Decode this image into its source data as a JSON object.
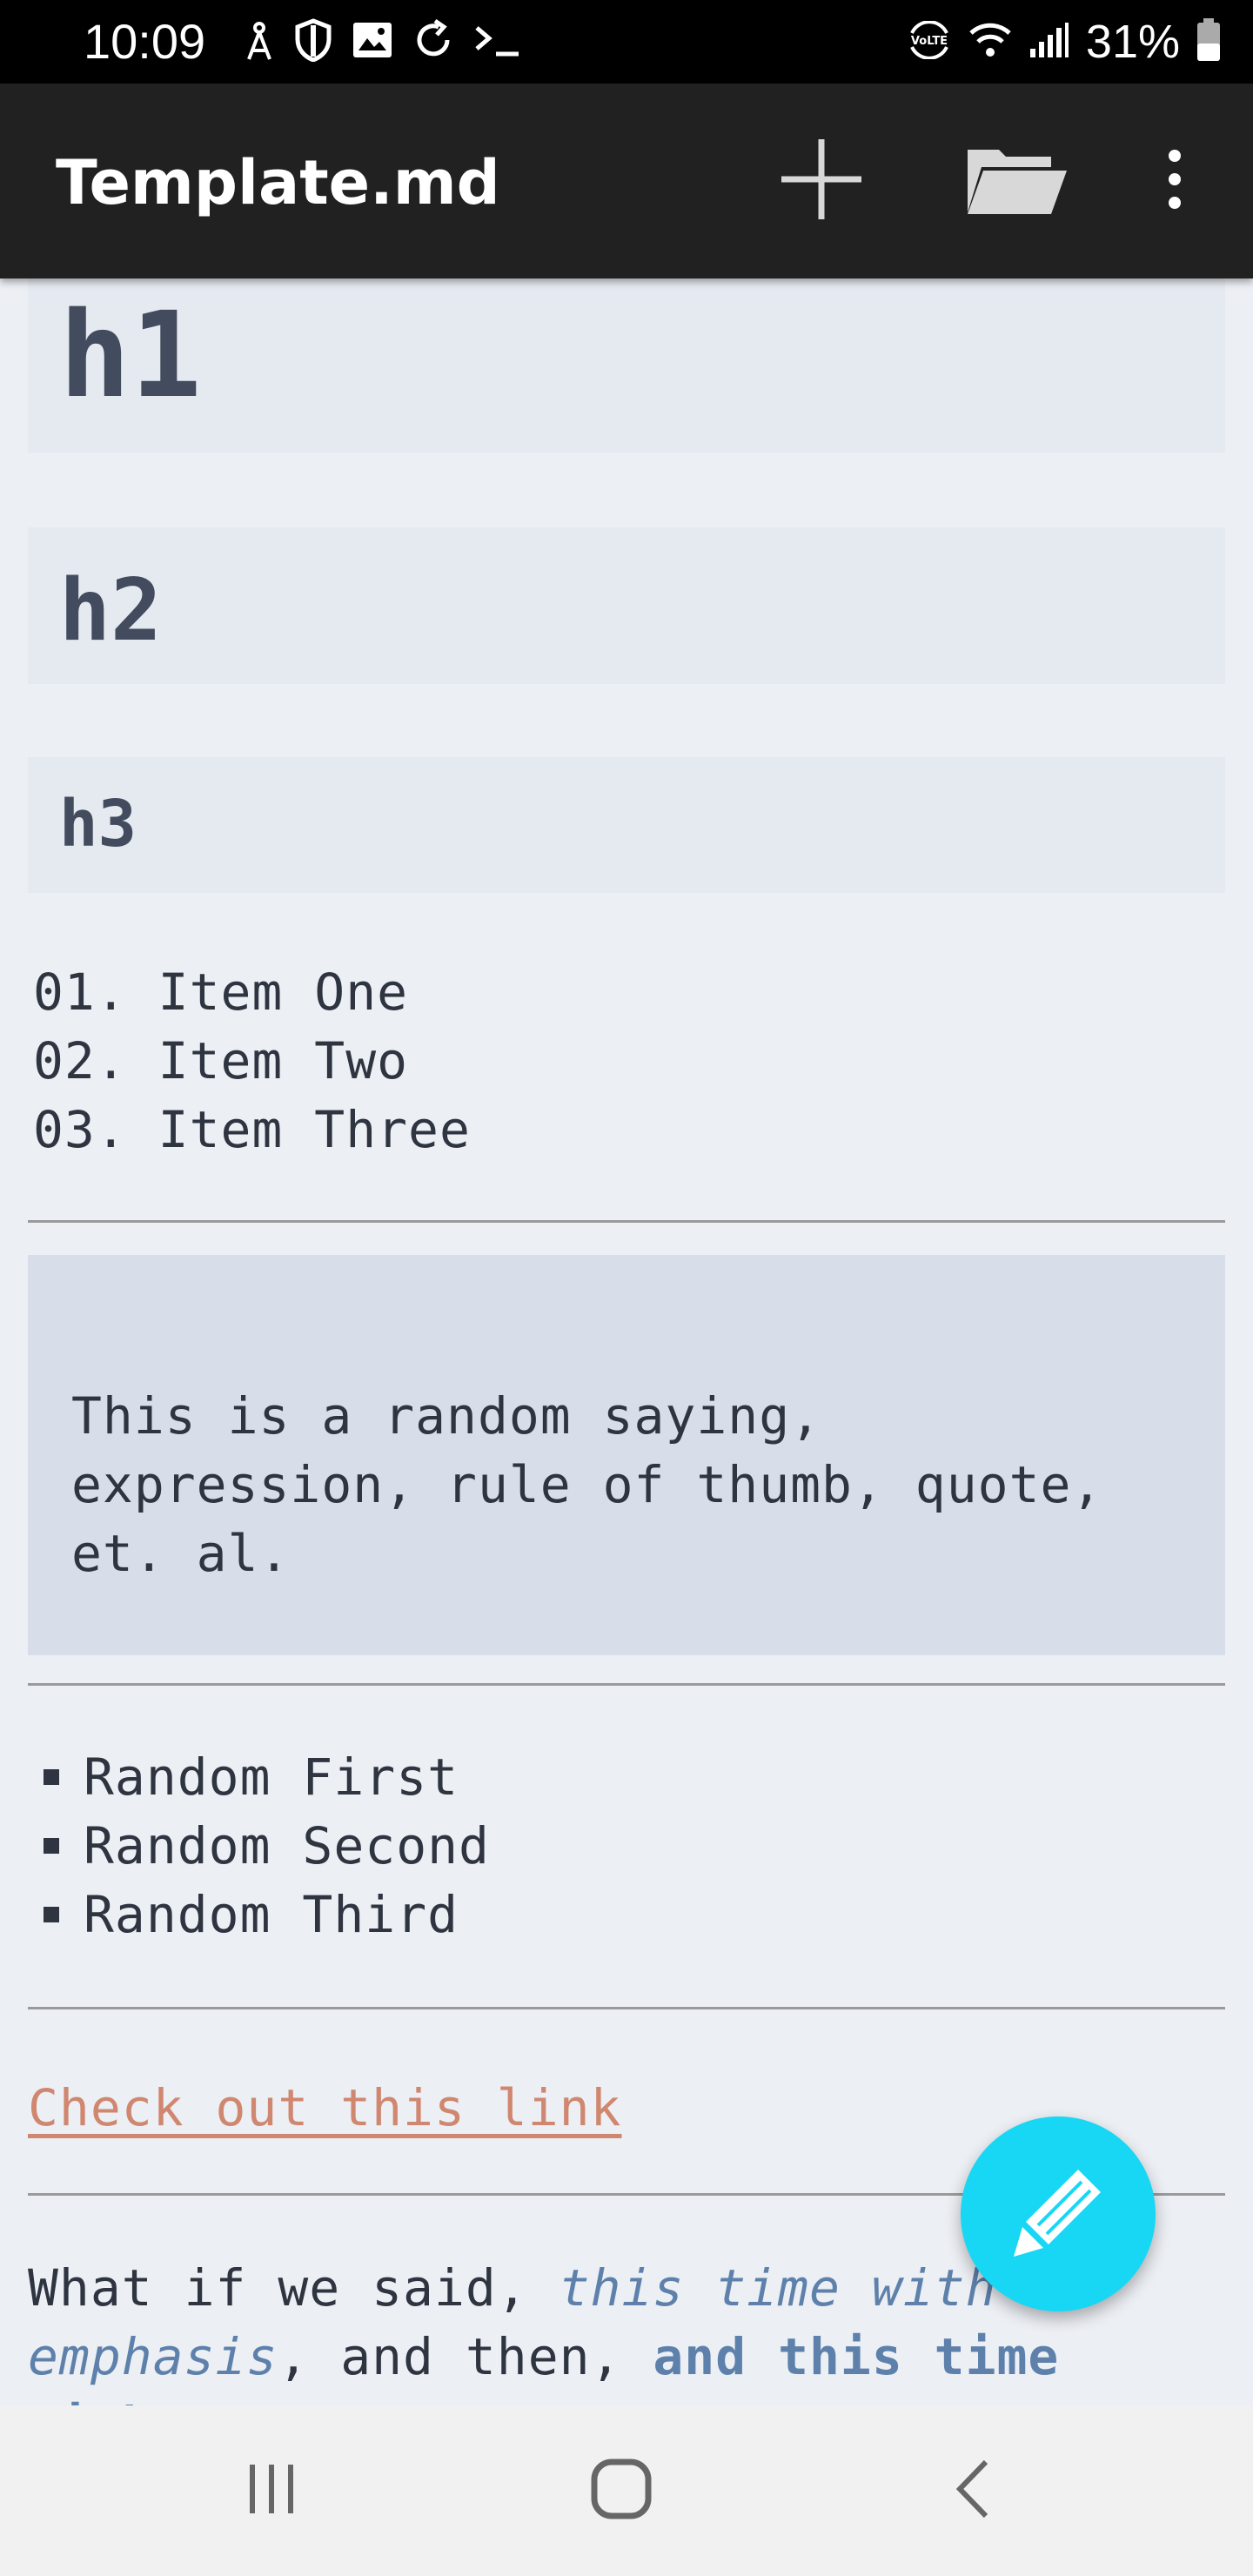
{
  "status_bar": {
    "time": "10:09",
    "battery": "31%",
    "left_icons": [
      "antenna-icon",
      "shield-icon",
      "image-icon",
      "sync-icon",
      "terminal-icon"
    ],
    "right_icons": [
      "volte-icon",
      "wifi-icon",
      "signal-icon",
      "battery-icon"
    ]
  },
  "app_bar": {
    "title": "Template.md",
    "actions": [
      "add-icon",
      "folder-open-icon",
      "more-vert-icon"
    ]
  },
  "content": {
    "h1": "h1",
    "h2": "h2",
    "h3": "h3",
    "ordered_list": [
      "01. Item One",
      "02. Item Two",
      "03. Item Three"
    ],
    "quote_lines": [
      "This is a random saying,",
      "expression, rule of thumb, quote,",
      "et. al."
    ],
    "bullet_list": [
      "Random First",
      "Random Second",
      "Random Third"
    ],
    "link_text": "Check out this link",
    "paragraph": {
      "part1": "What if we said, ",
      "emphasis": "this time with emphasis",
      "part2": ", and then, ",
      "strong": "and this time",
      "cut_off": "with ..."
    }
  },
  "fab": {
    "icon": "pencil-icon"
  },
  "nav_bar": {
    "buttons": [
      "recent-apps-icon",
      "home-icon",
      "back-icon"
    ]
  },
  "colors": {
    "background": "#eceff4",
    "app_bar": "#212121",
    "heading_box": "#e5e9f0",
    "quote_box": "#d8dee9",
    "link": "#d08770",
    "emphasis": "#5e81ac",
    "fab": "#17d7f5"
  }
}
